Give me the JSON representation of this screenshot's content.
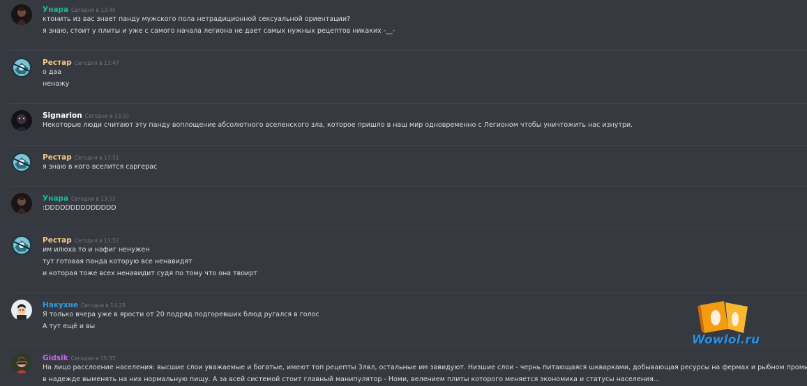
{
  "colors": {
    "background": "#36393f",
    "username_teal": "#1abc9c",
    "username_orange": "#f8c88a",
    "username_white": "#ffffff",
    "username_blue": "#3498db",
    "username_purple": "#c768e9",
    "timestamp": "#72767d",
    "message_text": "#dcddde"
  },
  "messages": [
    {
      "author": "Унара",
      "author_color": "#1abc9c",
      "timestamp": "Сегодня в 13:45",
      "avatar": "unara-avatar",
      "lines": [
        "ктонить из вас знает панду мужского пола нетрадиционной сексуальной ориентации?",
        "я знаю, стоит у плиты и уже с самого начала легиона не дает самых нужных рецептов никаких -__-"
      ]
    },
    {
      "author": "Рестар",
      "author_color": "#f8c88a",
      "timestamp": "Сегодня в 13:47",
      "avatar": "restar-avatar",
      "lines": [
        "о даа",
        "ненажу"
      ]
    },
    {
      "author": "Signarion",
      "author_color": "#ffffff",
      "timestamp": "Сегодня в 13:51",
      "avatar": "signarion-avatar",
      "lines": [
        "Некоторые люди считают эту панду воплощение абсолютного вселенского зла, которое пришло в наш мир одновременно с Легионом чтобы уничтожить нас изнутри."
      ]
    },
    {
      "author": "Рестар",
      "author_color": "#f8c88a",
      "timestamp": "Сегодня в 13:51",
      "avatar": "restar-avatar",
      "lines": [
        "я знаю в кого вселится саргерас"
      ]
    },
    {
      "author": "Унара",
      "author_color": "#1abc9c",
      "timestamp": "Сегодня в 13:52",
      "avatar": "unara-avatar",
      "lines": [
        ":DDDDDDDDDDDDDD"
      ]
    },
    {
      "author": "Рестар",
      "author_color": "#f8c88a",
      "timestamp": "Сегодня в 13:52",
      "avatar": "restar-avatar",
      "lines": [
        "им илюха то и нафиг ненужен",
        "тут готовая панда которую все ненавидят",
        "и которая тоже всех ненавидит судя по тому что она твоирт"
      ]
    },
    {
      "author": "Накухне",
      "author_color": "#3498db",
      "timestamp": "Сегодня в 14:23",
      "avatar": "nakukhne-avatar",
      "lines": [
        "Я только вчера уже в ярости от 20 подряд подгоревших блюд ругался в голос",
        "А тут ещё и вы"
      ]
    },
    {
      "author": "Gidsik",
      "author_color": "#c768e9",
      "timestamp": "Сегодня в 15:37",
      "avatar": "gidsik-avatar",
      "lines": [
        "На лицо расслоение населения: высшие слои уважаемые и богатые, имеют топ рецепты 3лвл, остальные им завидуют. Низшие слои - чернь питающаяся шкварками, добывающая ресурсы на фермах и рыбном промысле,",
        "в надежде выменять на них нормальную пищу. А за всей системой стоит главный манипулятор - Номи, велением плиты которого меняется экономика и статусы населения..."
      ]
    }
  ],
  "watermark": {
    "text": "Wowlol.ru",
    "icon": "wowlol-logo"
  }
}
